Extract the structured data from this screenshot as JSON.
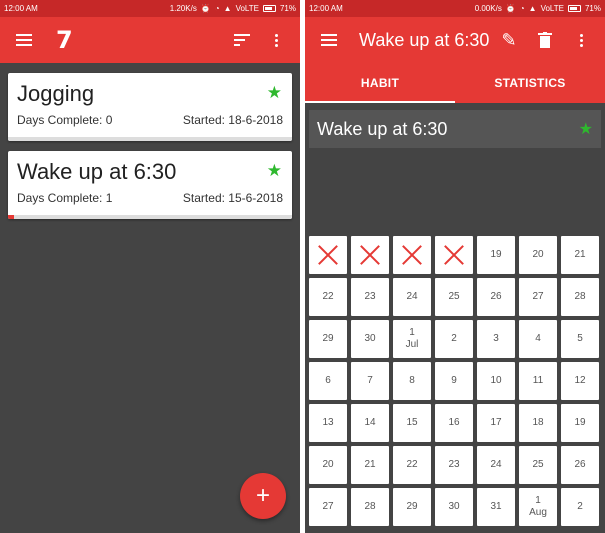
{
  "left": {
    "statusbar": {
      "time": "12:00 AM",
      "speed": "1.20K/s",
      "network": "VoLTE",
      "battery": "71%"
    },
    "toolbar": {
      "logo": "7"
    },
    "habits": [
      {
        "title": "Jogging",
        "days_label": "Days Complete: 0",
        "started_label": "Started: 18-6-2018",
        "progress": 0.0
      },
      {
        "title": "Wake up at 6:30",
        "days_label": "Days Complete: 1",
        "started_label": "Started: 15-6-2018",
        "progress": 0.02
      }
    ],
    "fab": {
      "label": "+"
    }
  },
  "right": {
    "statusbar": {
      "time": "12:00 AM",
      "speed": "0.00K/s",
      "network": "VoLTE",
      "battery": "71%"
    },
    "toolbar": {
      "title": "Wake up at 6:30"
    },
    "tabs": [
      "HABIT",
      "STATISTICS"
    ],
    "active_tab": "HABIT",
    "habit_title": "Wake up at 6:30",
    "calendar": [
      {
        "day": "",
        "month": "",
        "status": "missed"
      },
      {
        "day": "",
        "month": "",
        "status": "missed"
      },
      {
        "day": "",
        "month": "",
        "status": "missed"
      },
      {
        "day": "",
        "month": "",
        "status": "missed"
      },
      {
        "day": "19",
        "month": ""
      },
      {
        "day": "20",
        "month": ""
      },
      {
        "day": "21",
        "month": ""
      },
      {
        "day": "22",
        "month": ""
      },
      {
        "day": "23",
        "month": ""
      },
      {
        "day": "24",
        "month": ""
      },
      {
        "day": "25",
        "month": ""
      },
      {
        "day": "26",
        "month": ""
      },
      {
        "day": "27",
        "month": ""
      },
      {
        "day": "28",
        "month": ""
      },
      {
        "day": "29",
        "month": ""
      },
      {
        "day": "30",
        "month": ""
      },
      {
        "day": "1",
        "month": "Jul"
      },
      {
        "day": "2",
        "month": ""
      },
      {
        "day": "3",
        "month": ""
      },
      {
        "day": "4",
        "month": ""
      },
      {
        "day": "5",
        "month": ""
      },
      {
        "day": "6",
        "month": ""
      },
      {
        "day": "7",
        "month": ""
      },
      {
        "day": "8",
        "month": ""
      },
      {
        "day": "9",
        "month": ""
      },
      {
        "day": "10",
        "month": ""
      },
      {
        "day": "11",
        "month": ""
      },
      {
        "day": "12",
        "month": ""
      },
      {
        "day": "13",
        "month": ""
      },
      {
        "day": "14",
        "month": ""
      },
      {
        "day": "15",
        "month": ""
      },
      {
        "day": "16",
        "month": ""
      },
      {
        "day": "17",
        "month": ""
      },
      {
        "day": "18",
        "month": ""
      },
      {
        "day": "19",
        "month": ""
      },
      {
        "day": "20",
        "month": ""
      },
      {
        "day": "21",
        "month": ""
      },
      {
        "day": "22",
        "month": ""
      },
      {
        "day": "23",
        "month": ""
      },
      {
        "day": "24",
        "month": ""
      },
      {
        "day": "25",
        "month": ""
      },
      {
        "day": "26",
        "month": ""
      },
      {
        "day": "27",
        "month": ""
      },
      {
        "day": "28",
        "month": ""
      },
      {
        "day": "29",
        "month": ""
      },
      {
        "day": "30",
        "month": ""
      },
      {
        "day": "31",
        "month": ""
      },
      {
        "day": "1",
        "month": "Aug"
      },
      {
        "day": "2",
        "month": ""
      }
    ]
  },
  "colors": {
    "primary": "#e53935",
    "dark": "#c62828",
    "background": "#444444",
    "star": "#2eb82e"
  },
  "icons": {
    "menu": "hamburger-icon",
    "sort": "sort-icon",
    "overflow": "more-vert-icon",
    "edit": "pencil-icon",
    "delete": "trash-icon",
    "favorite": "star-icon",
    "add": "plus-icon"
  }
}
